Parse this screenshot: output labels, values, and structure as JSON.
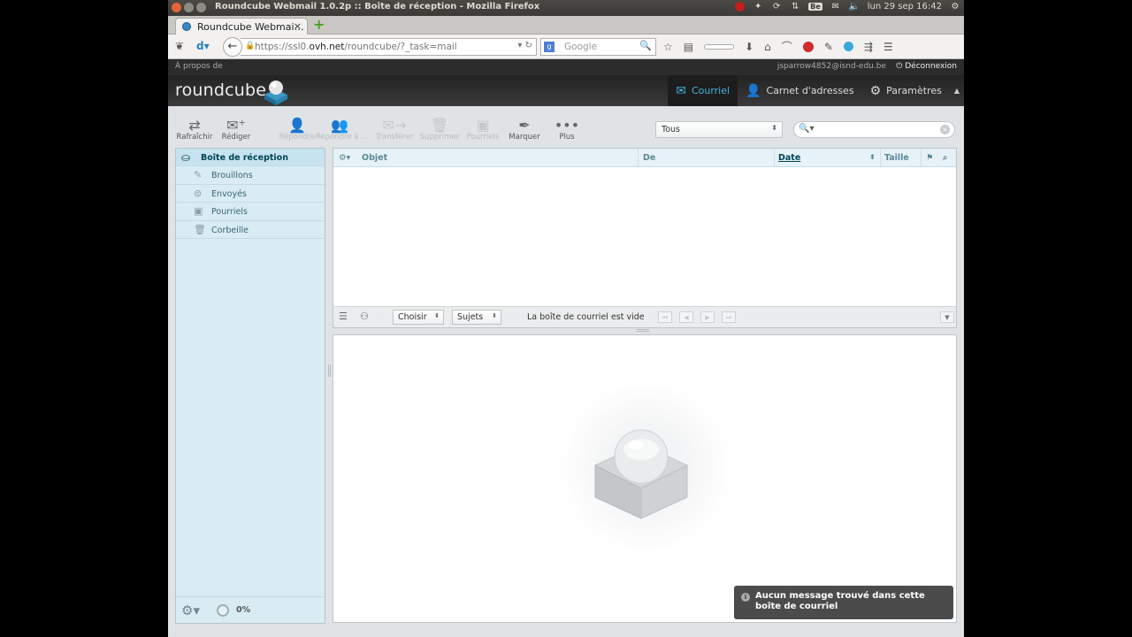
{
  "os": {
    "window_title": "Roundcube Webmail 1.0.2p :: Boîte de réception - Mozilla Firefox",
    "clock": "lun 29 sep 16:42",
    "tray_be": "Be"
  },
  "browser": {
    "tab_title": "Roundcube Webmai…",
    "url_prefix": "https://ssl0.",
    "url_domain": "ovh.net",
    "url_path": "/roundcube/?_task=mail",
    "search_placeholder": "Google"
  },
  "rc": {
    "about": "À propos de",
    "user": "jsparrow4852@isnd-edu.be",
    "logout": "Déconnexion",
    "logo": "roundcube",
    "tasks": [
      "Courriel",
      "Carnet d'adresses",
      "Paramètres"
    ]
  },
  "toolbar": {
    "buttons": [
      "Rafraîchir",
      "Rédiger",
      "Répondre",
      "Répondre à …",
      "Transférer",
      "Supprimer",
      "Pourriels",
      "Marquer",
      "Plus"
    ],
    "filter": "Tous"
  },
  "folders": [
    "Boîte de réception",
    "Brouillons",
    "Envoyés",
    "Pourriels",
    "Corbeille"
  ],
  "quota": "0%",
  "list": {
    "columns": [
      "Objet",
      "De",
      "Date",
      "Taille"
    ],
    "select_label": "Choisir",
    "threads_label": "Sujets",
    "status": "La boîte de courriel est vide"
  },
  "notice": "Aucun message trouvé dans cette boîte de courriel",
  "colors": {
    "accent": "#45b4e0",
    "folder_bg": "#d9ecf4",
    "header_bg": "#2c2c2c"
  }
}
